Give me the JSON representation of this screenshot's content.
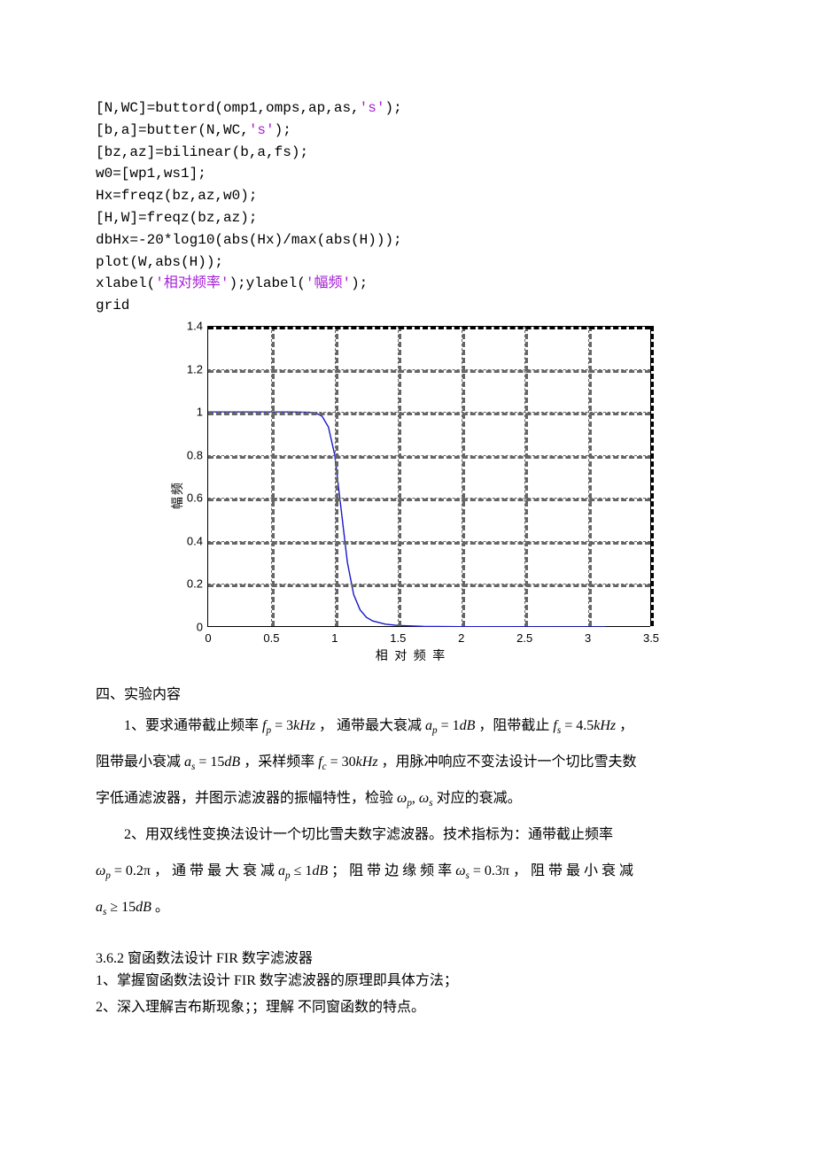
{
  "code": {
    "l1a": "[N,WC]=buttord(omp1,omps,ap,as,",
    "l1b": ");",
    "l2a": "[b,a]=butter(N,WC,",
    "l2b": ");",
    "l3": "[bz,az]=bilinear(b,a,fs);",
    "l4": "w0=[wp1,ws1];",
    "l5": "Hx=freqz(bz,az,w0);",
    "l6": "[H,W]=freqz(bz,az);",
    "l7": "dbHx=-20*log10(abs(Hx)/max(abs(H)));",
    "l8": "plot(W,abs(H));",
    "l9a": "xlabel(",
    "l9b": ");ylabel(",
    "l9c": ");",
    "l10": "grid",
    "s_quote_s": "'s'",
    "s_xlabel": "'相对频率'",
    "s_ylabel": "'幅频'"
  },
  "chart_data": {
    "type": "line",
    "title": "",
    "xlabel": "相 对 频 率",
    "ylabel": "幅频",
    "xlim": [
      0,
      3.5
    ],
    "ylim": [
      0,
      1.4
    ],
    "xticks": [
      0,
      0.5,
      1,
      1.5,
      2,
      2.5,
      3,
      3.5
    ],
    "yticks": [
      0,
      0.2,
      0.4,
      0.6,
      0.8,
      1,
      1.2,
      1.4
    ],
    "series": [
      {
        "name": "abs(H)",
        "color": "#1818c8",
        "x": [
          0,
          0.2,
          0.4,
          0.6,
          0.7,
          0.8,
          0.85,
          0.9,
          0.95,
          1.0,
          1.05,
          1.1,
          1.15,
          1.2,
          1.25,
          1.3,
          1.4,
          1.5,
          1.7,
          2.0,
          2.5,
          3.0,
          3.1416
        ],
        "values": [
          1.0,
          1.0,
          1.0,
          1.0,
          0.999,
          0.998,
          0.995,
          0.98,
          0.93,
          0.8,
          0.55,
          0.3,
          0.15,
          0.08,
          0.045,
          0.028,
          0.013,
          0.007,
          0.003,
          0.001,
          0.0005,
          0.0003,
          0.0003
        ]
      }
    ]
  },
  "body": {
    "sec4": "四、实验内容",
    "p1_a": "1、要求通带截止频率 ",
    "p1_fp": "f",
    "p1_fp_sub": "p",
    "p1_fp_eq": " = 3",
    "p1_fp_unit": "kHz",
    "p1_b": " ， 通带最大衰减 ",
    "p1_ap": "a",
    "p1_ap_sub": "p",
    "p1_ap_eq": " = 1",
    "p1_ap_unit": "dB",
    "p1_c": " ，阻带截止 ",
    "p1_fs": "f",
    "p1_fs_sub": "s",
    "p1_fs_eq": " = 4.5",
    "p1_fs_unit": "kHz",
    "p1_d": " ，",
    "p2_a_noindent": "阻带最小衰减 ",
    "p2_as": "a",
    "p2_as_sub": "s",
    "p2_as_eq": " = 15",
    "p2_as_unit": "dB",
    "p2_b": " ，采样频率 ",
    "p2_fc": "f",
    "p2_fc_sub": "c",
    "p2_fc_eq": " = 30",
    "p2_fc_unit": "kHz",
    "p2_c": " ，用脉冲响应不变法设计一个切比雪夫数",
    "p3_noindent": "字低通滤波器，并图示滤波器的振幅特性，检验 ",
    "p3_wp": "ω",
    "p3_wp_sub": "p",
    "p3_comma": ", ",
    "p3_ws": "ω",
    "p3_ws_sub": "s",
    "p3_b": " 对应的衰减。",
    "p4_a": "2、用双线性变换法设计一个切比雪夫数字滤波器。技术指标为：通带截止频率",
    "p5_a_noindent_wp": "ω",
    "p5_wp_sub": "p",
    "p5_wp_eq": " = 0.2π",
    "p5_b": " ， 通 带 最 大 衰 减 ",
    "p5_ap": "a",
    "p5_ap_sub": "p",
    "p5_ap_eq": " ≤ 1",
    "p5_ap_unit": "dB",
    "p5_c": " ； 阻 带 边 缘 频 率 ",
    "p5_ws": "ω",
    "p5_ws_sub": "s",
    "p5_ws_eq": " = 0.3π",
    "p5_d": " ， 阻 带 最 小 衰 减",
    "p6_noindent_as": "a",
    "p6_as_sub": "s",
    "p6_as_eq": " ≥ 15",
    "p6_as_unit": "dB",
    "p6_b": " 。",
    "sub362": "3.6.2 窗函数法设计 FIR 数字滤波器",
    "li1": "1、掌握窗函数法设计 FIR 数字滤波器的原理即具体方法；",
    "li2": "2、深入理解吉布斯现象；；理解  不同窗函数的特点。"
  }
}
